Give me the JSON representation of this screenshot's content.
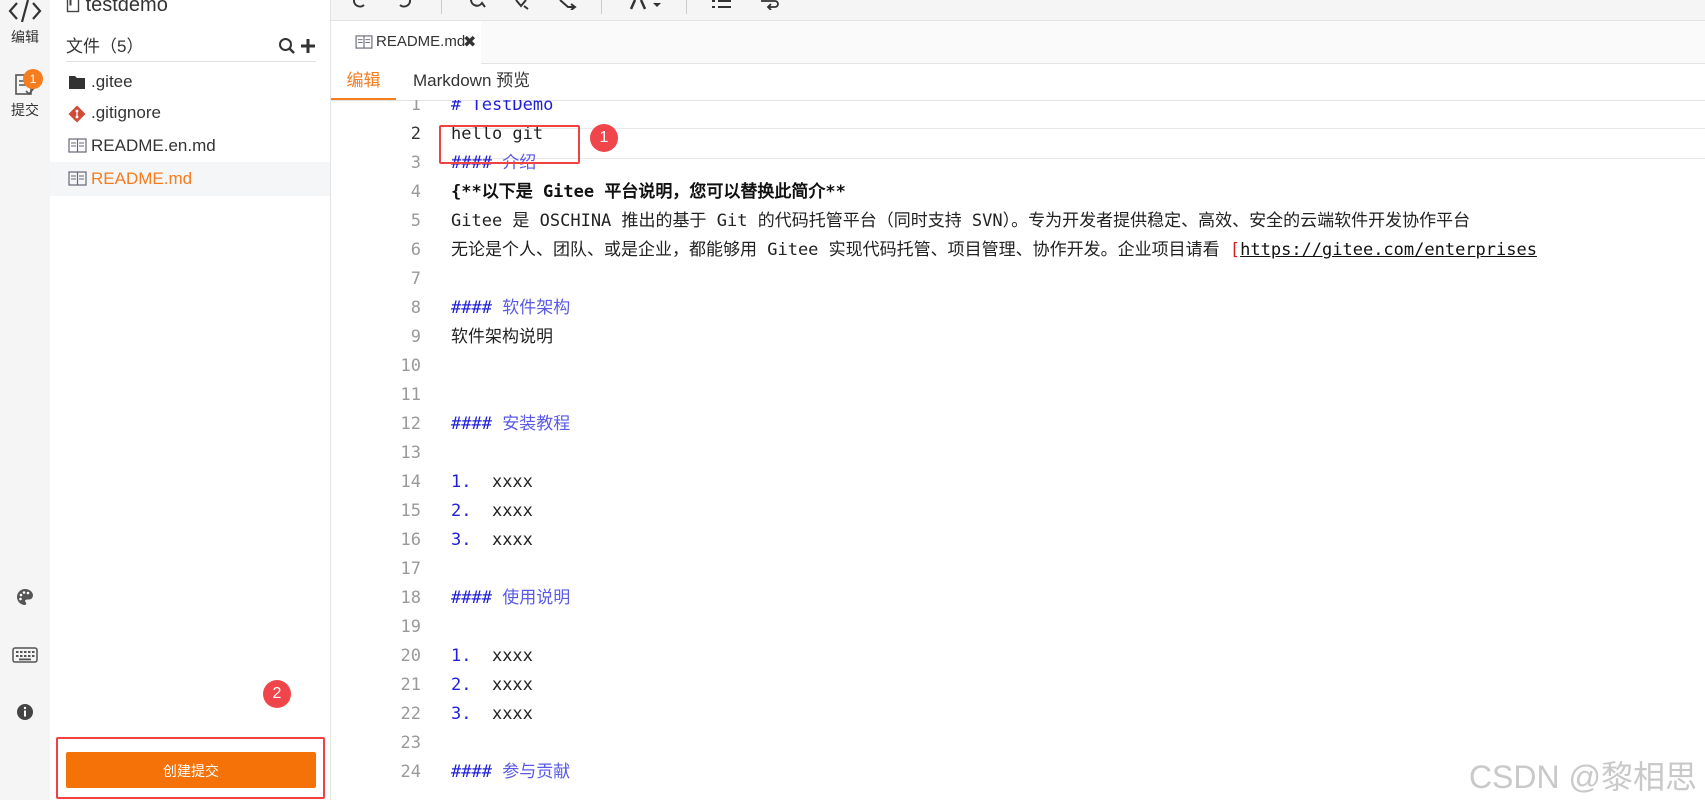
{
  "activity": {
    "edit_label": "编辑",
    "commit_label": "提交",
    "commit_badge": "1"
  },
  "sidebar": {
    "repo_name": "testdemo",
    "files_title": "文件（5）",
    "files": [
      {
        "name": ".gitee",
        "icon": "folder-icon"
      },
      {
        "name": ".gitignore",
        "icon": "git-icon"
      },
      {
        "name": "README.en.md",
        "icon": "book-icon"
      },
      {
        "name": "README.md",
        "icon": "book-icon",
        "active": true
      }
    ],
    "callout2": "2",
    "commit_button": "创建提交"
  },
  "editor": {
    "tab_name": "README.md",
    "tab_close": "✖",
    "mode_edit": "编辑",
    "mode_preview": "Markdown 预览",
    "callout1": "1",
    "lines": [
      {
        "n": "1",
        "t": "# TestDemo"
      },
      {
        "n": "2",
        "t": "hello git"
      },
      {
        "n": "3",
        "h": "####",
        "t": " 介绍"
      },
      {
        "n": "4",
        "t": "{**以下是 Gitee 平台说明，您可以替换此简介**"
      },
      {
        "n": "5",
        "t": "Gitee 是 OSCHINA 推出的基于 Git 的代码托管平台（同时支持 SVN）。专为开发者提供稳定、高效、安全的云端软件开发协作平台"
      },
      {
        "n": "6",
        "t": "无论是个人、团队、或是企业，都能够用 Gitee 实现代码托管、项目管理、协作开发。企业项目请看 ",
        "lb": "[",
        "link": "https://gitee.com/enterprises"
      },
      {
        "n": "7",
        "t": ""
      },
      {
        "n": "8",
        "h": "####",
        "t": " 软件架构"
      },
      {
        "n": "9",
        "t": "软件架构说明"
      },
      {
        "n": "10",
        "t": ""
      },
      {
        "n": "11",
        "t": ""
      },
      {
        "n": "12",
        "h": "####",
        "t": " 安装教程"
      },
      {
        "n": "13",
        "t": ""
      },
      {
        "n": "14",
        "h": "1.",
        "t": "  xxxx"
      },
      {
        "n": "15",
        "h": "2.",
        "t": "  xxxx"
      },
      {
        "n": "16",
        "h": "3.",
        "t": "  xxxx"
      },
      {
        "n": "17",
        "t": ""
      },
      {
        "n": "18",
        "h": "####",
        "t": " 使用说明"
      },
      {
        "n": "19",
        "t": ""
      },
      {
        "n": "20",
        "h": "1.",
        "t": "  xxxx"
      },
      {
        "n": "21",
        "h": "2.",
        "t": "  xxxx"
      },
      {
        "n": "22",
        "h": "3.",
        "t": "  xxxx"
      },
      {
        "n": "23",
        "t": ""
      },
      {
        "n": "24",
        "h": "####",
        "t": " 参与贡献"
      }
    ]
  },
  "watermark": "CSDN @黎相思",
  "colors": {
    "accent": "#f57c1f",
    "button": "#f57208",
    "callout": "#f0454a",
    "heading": "#1f1fd8"
  }
}
